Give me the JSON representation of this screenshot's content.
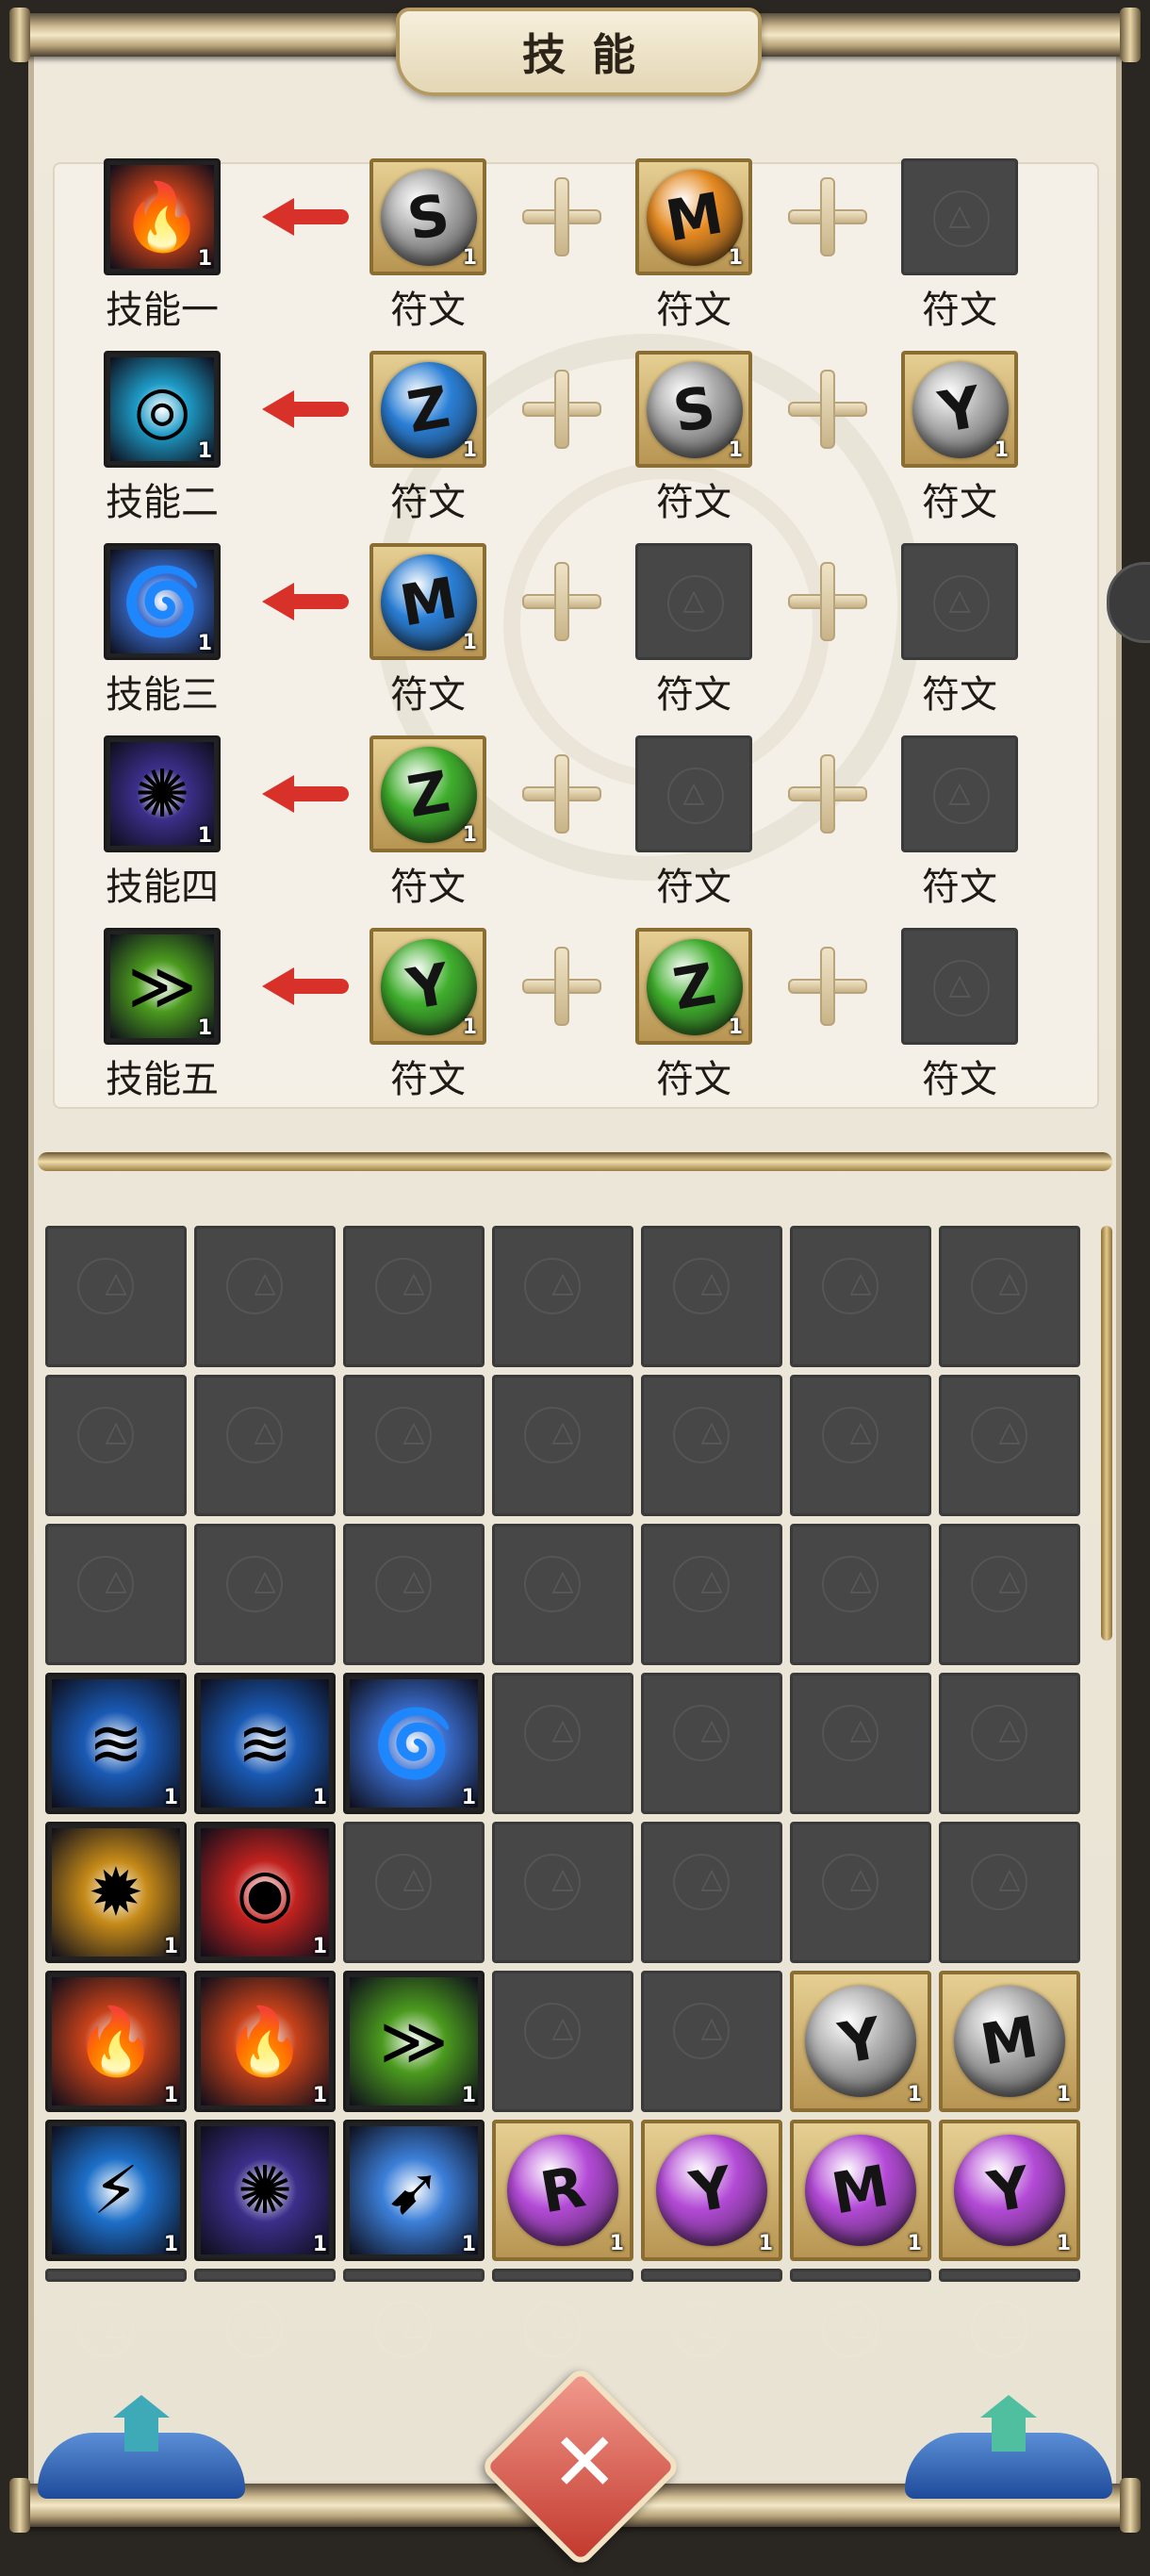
{
  "title": "技能",
  "skills": [
    {
      "label": "技能一",
      "qty": "1",
      "icon": "fireball-icon",
      "color": "#c7421a",
      "runes": [
        {
          "label": "符文",
          "qty": "1",
          "color": "#a9a9a9",
          "glyph": "S",
          "filled": true
        },
        {
          "label": "符文",
          "qty": "1",
          "color": "#e58a21",
          "glyph": "M",
          "filled": true
        },
        {
          "label": "符文",
          "filled": false
        }
      ]
    },
    {
      "label": "技能二",
      "qty": "1",
      "icon": "water-ring-icon",
      "color": "#1e9bc6",
      "runes": [
        {
          "label": "符文",
          "qty": "1",
          "color": "#2a7fd6",
          "glyph": "Z",
          "filled": true
        },
        {
          "label": "符文",
          "qty": "1",
          "color": "#a9a9a9",
          "glyph": "S",
          "filled": true
        },
        {
          "label": "符文",
          "qty": "1",
          "color": "#b0b0b0",
          "glyph": "Y",
          "filled": true
        }
      ]
    },
    {
      "label": "技能三",
      "qty": "1",
      "icon": "whirlwind-icon",
      "color": "#3b6fd0",
      "runes": [
        {
          "label": "符文",
          "qty": "1",
          "color": "#2a7fd6",
          "glyph": "M",
          "filled": true
        },
        {
          "label": "符文",
          "filled": false
        },
        {
          "label": "符文",
          "filled": false
        }
      ]
    },
    {
      "label": "技能四",
      "qty": "1",
      "icon": "vortex-icon",
      "color": "#3b2f8a",
      "runes": [
        {
          "label": "符文",
          "qty": "1",
          "color": "#3fae2c",
          "glyph": "Z",
          "filled": true
        },
        {
          "label": "符文",
          "filled": false
        },
        {
          "label": "符文",
          "filled": false
        }
      ]
    },
    {
      "label": "技能五",
      "qty": "1",
      "icon": "sprint-icon",
      "color": "#4b9a1e",
      "runes": [
        {
          "label": "符文",
          "qty": "1",
          "color": "#3fae2c",
          "glyph": "Y",
          "filled": true
        },
        {
          "label": "符文",
          "qty": "1",
          "color": "#3fae2c",
          "glyph": "Z",
          "filled": true
        },
        {
          "label": "符文",
          "filled": false
        }
      ]
    }
  ],
  "inventory": [
    {
      "row": 3,
      "col": 0,
      "qty": "1",
      "kind": "icon",
      "icon": "storm-slash-icon",
      "color": "#1a5ab4"
    },
    {
      "row": 3,
      "col": 1,
      "qty": "1",
      "kind": "icon",
      "icon": "storm-slash-icon",
      "color": "#1a5ab4"
    },
    {
      "row": 3,
      "col": 2,
      "qty": "1",
      "kind": "icon",
      "icon": "whirlwind-icon",
      "color": "#3b6fd0"
    },
    {
      "row": 4,
      "col": 0,
      "qty": "1",
      "kind": "icon",
      "icon": "golden-strike-icon",
      "color": "#c58a18"
    },
    {
      "row": 4,
      "col": 1,
      "qty": "1",
      "kind": "icon",
      "icon": "red-vortex-icon",
      "color": "#c0221e"
    },
    {
      "row": 5,
      "col": 0,
      "qty": "1",
      "kind": "icon",
      "icon": "fireball-icon",
      "color": "#c7421a"
    },
    {
      "row": 5,
      "col": 1,
      "qty": "1",
      "kind": "icon",
      "icon": "fireball-icon",
      "color": "#c7421a"
    },
    {
      "row": 5,
      "col": 2,
      "qty": "1",
      "kind": "icon",
      "icon": "sprint-icon",
      "color": "#4b9a1e"
    },
    {
      "row": 5,
      "col": 5,
      "qty": "1",
      "kind": "rune",
      "color": "#b0b0b0",
      "glyph": "Y"
    },
    {
      "row": 5,
      "col": 6,
      "qty": "1",
      "kind": "rune",
      "color": "#a9a9a9",
      "glyph": "M"
    },
    {
      "row": 6,
      "col": 0,
      "qty": "1",
      "kind": "icon",
      "icon": "lightning-orb-icon",
      "color": "#1d6fc8"
    },
    {
      "row": 6,
      "col": 1,
      "qty": "1",
      "kind": "icon",
      "icon": "vortex-icon",
      "color": "#3b2f8a"
    },
    {
      "row": 6,
      "col": 2,
      "qty": "1",
      "kind": "icon",
      "icon": "spear-thrust-icon",
      "color": "#3c7fd8"
    },
    {
      "row": 6,
      "col": 3,
      "qty": "1",
      "kind": "rune",
      "color": "#b34ad6",
      "glyph": "R"
    },
    {
      "row": 6,
      "col": 4,
      "qty": "1",
      "kind": "rune",
      "color": "#b34ad6",
      "glyph": "Y"
    },
    {
      "row": 6,
      "col": 5,
      "qty": "1",
      "kind": "rune",
      "color": "#b34ad6",
      "glyph": "M"
    },
    {
      "row": 6,
      "col": 6,
      "qty": "1",
      "kind": "rune",
      "color": "#b34ad6",
      "glyph": "Y"
    }
  ],
  "icon_glyphs": {
    "fireball-icon": "🔥",
    "water-ring-icon": "◎",
    "whirlwind-icon": "🌀",
    "vortex-icon": "✺",
    "sprint-icon": "≫",
    "storm-slash-icon": "≋",
    "golden-strike-icon": "✹",
    "red-vortex-icon": "◉",
    "lightning-orb-icon": "⚡",
    "spear-thrust-icon": "➹"
  },
  "close_label": "✕"
}
